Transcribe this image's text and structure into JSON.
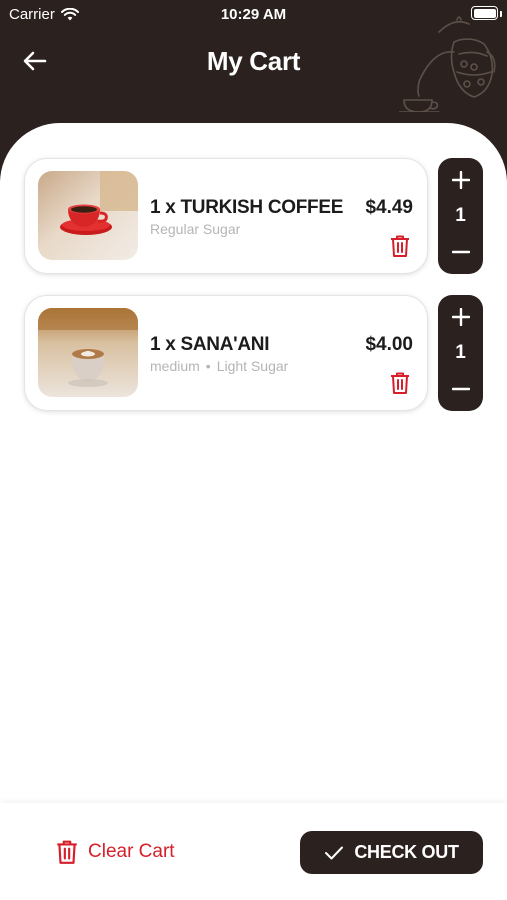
{
  "status_bar": {
    "carrier": "Carrier",
    "time": "10:29 AM"
  },
  "header": {
    "title": "My Cart"
  },
  "colors": {
    "header_bg": "#2b211f",
    "accent_red": "#d51f2a",
    "muted_text": "#b5b5b5"
  },
  "icons": [
    "wifi-icon",
    "battery-icon",
    "back-arrow-icon",
    "coffee-pot-art",
    "trash-icon",
    "plus-icon",
    "minus-icon",
    "checkmark-icon"
  ],
  "cart": {
    "items": [
      {
        "name": "1 x TURKISH COFFEE",
        "option1": "Regular Sugar",
        "price": "$4.49",
        "quantity": "1"
      },
      {
        "name": "1 x SANA'ANI",
        "option1": "medium",
        "separator": "•",
        "option2": "Light Sugar",
        "price": "$4.00",
        "quantity": "1"
      }
    ]
  },
  "footer": {
    "clear_label": "Clear Cart",
    "checkout_label": "CHECK OUT"
  }
}
